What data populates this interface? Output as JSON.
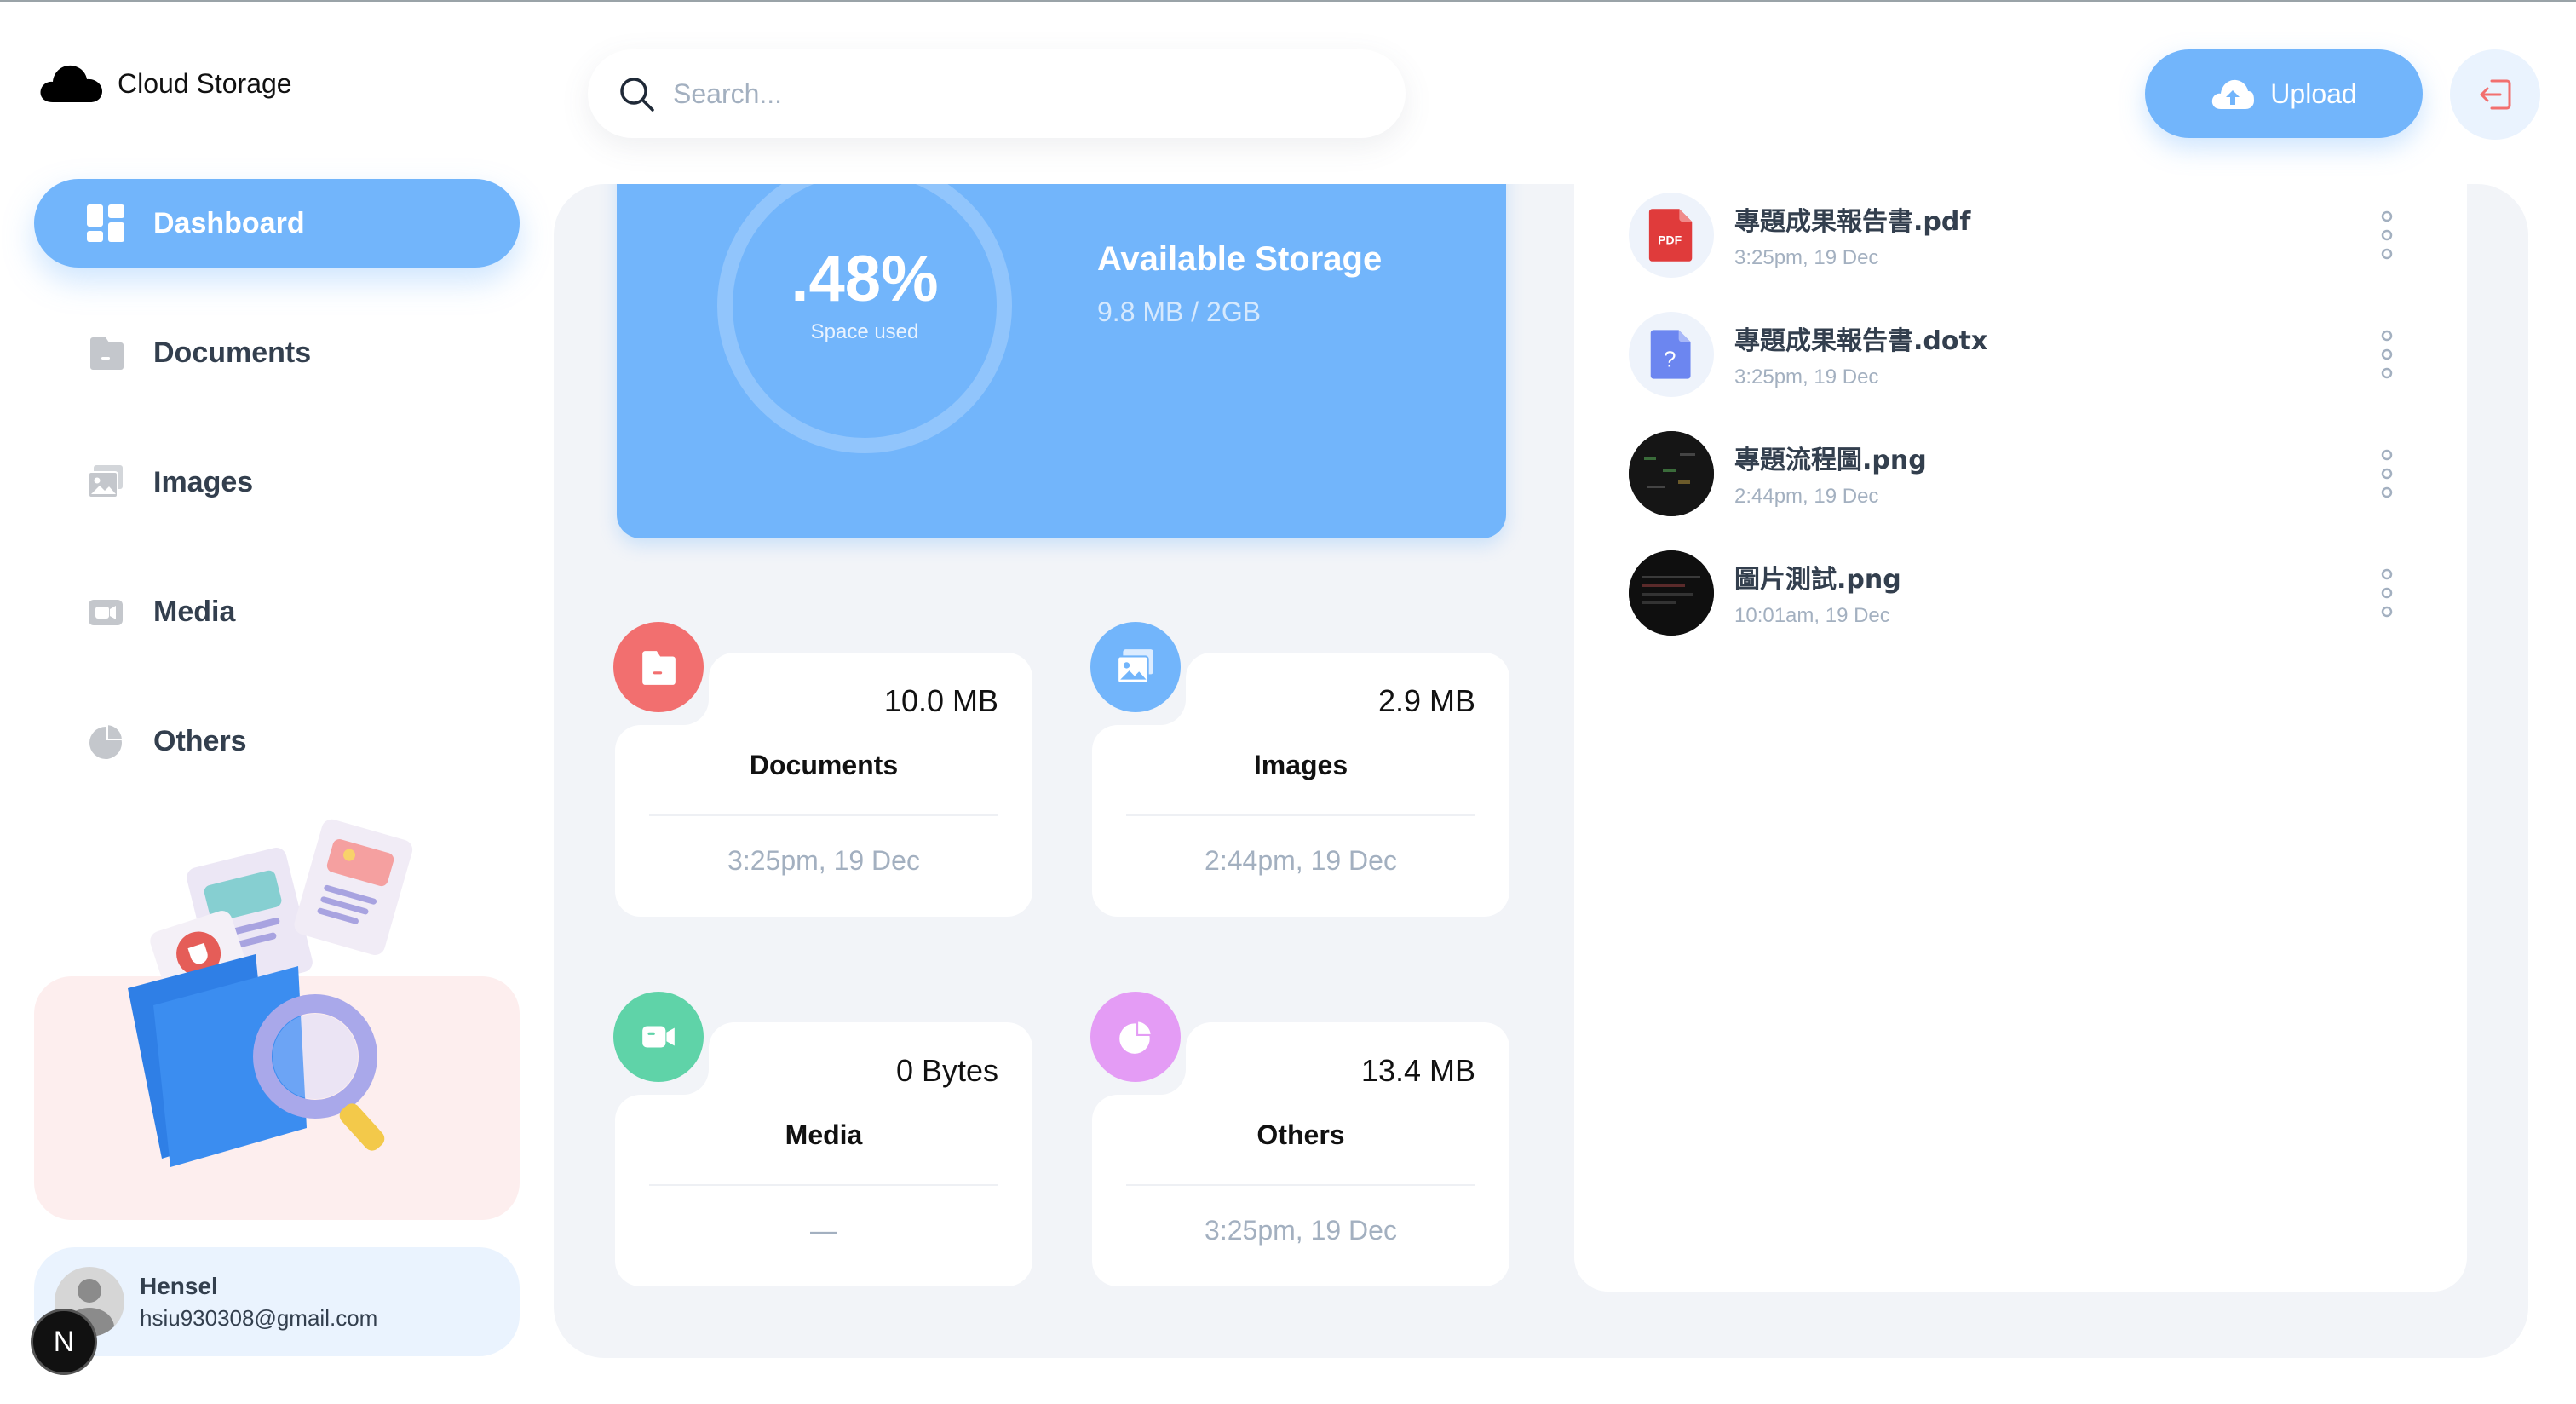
{
  "app": {
    "title": "Cloud Storage"
  },
  "search": {
    "placeholder": "Search..."
  },
  "header": {
    "upload_label": "Upload"
  },
  "sidebar": {
    "items": [
      {
        "label": "Dashboard",
        "icon": "dashboard-icon",
        "active": true
      },
      {
        "label": "Documents",
        "icon": "document-icon",
        "active": false
      },
      {
        "label": "Images",
        "icon": "images-icon",
        "active": false
      },
      {
        "label": "Media",
        "icon": "video-icon",
        "active": false
      },
      {
        "label": "Others",
        "icon": "pie-chart-icon",
        "active": false
      }
    ]
  },
  "user": {
    "name": "Hensel",
    "email": "hsiu930308@gmail.com"
  },
  "badge": {
    "letter": "N"
  },
  "storage": {
    "percent_label": ".48%",
    "percent_value": 0.48,
    "used_label": "Space used",
    "title": "Available Storage",
    "value": "9.8 MB / 2GB"
  },
  "categories": [
    {
      "name": "Documents",
      "size": "10.0 MB",
      "date": "3:25pm, 19 Dec",
      "color": "#f26f6f",
      "icon": "document-icon"
    },
    {
      "name": "Images",
      "size": "2.9 MB",
      "date": "2:44pm, 19 Dec",
      "color": "#72b5fb",
      "icon": "images-icon"
    },
    {
      "name": "Media",
      "size": "0 Bytes",
      "date": "—",
      "color": "#5fd3a8",
      "icon": "video-icon"
    },
    {
      "name": "Others",
      "size": "13.4 MB",
      "date": "3:25pm, 19 Dec",
      "color": "#e49cf5",
      "icon": "pie-chart-icon"
    }
  ],
  "recent": [
    {
      "name": "專題成果報告書.pdf",
      "date": "3:25pm, 19 Dec",
      "type": "pdf",
      "thumb_label": "PDF"
    },
    {
      "name": "專題成果報告書.dotx",
      "date": "3:25pm, 19 Dec",
      "type": "unknown",
      "thumb_label": "?"
    },
    {
      "name": "專題流程圖.png",
      "date": "2:44pm, 19 Dec",
      "type": "image"
    },
    {
      "name": "圖片測試.png",
      "date": "10:01am, 19 Dec",
      "type": "image"
    }
  ],
  "colors": {
    "accent": "#72b5fb",
    "danger": "#f26f6f",
    "text": "#333f4e",
    "muted": "#a3b0c0"
  }
}
